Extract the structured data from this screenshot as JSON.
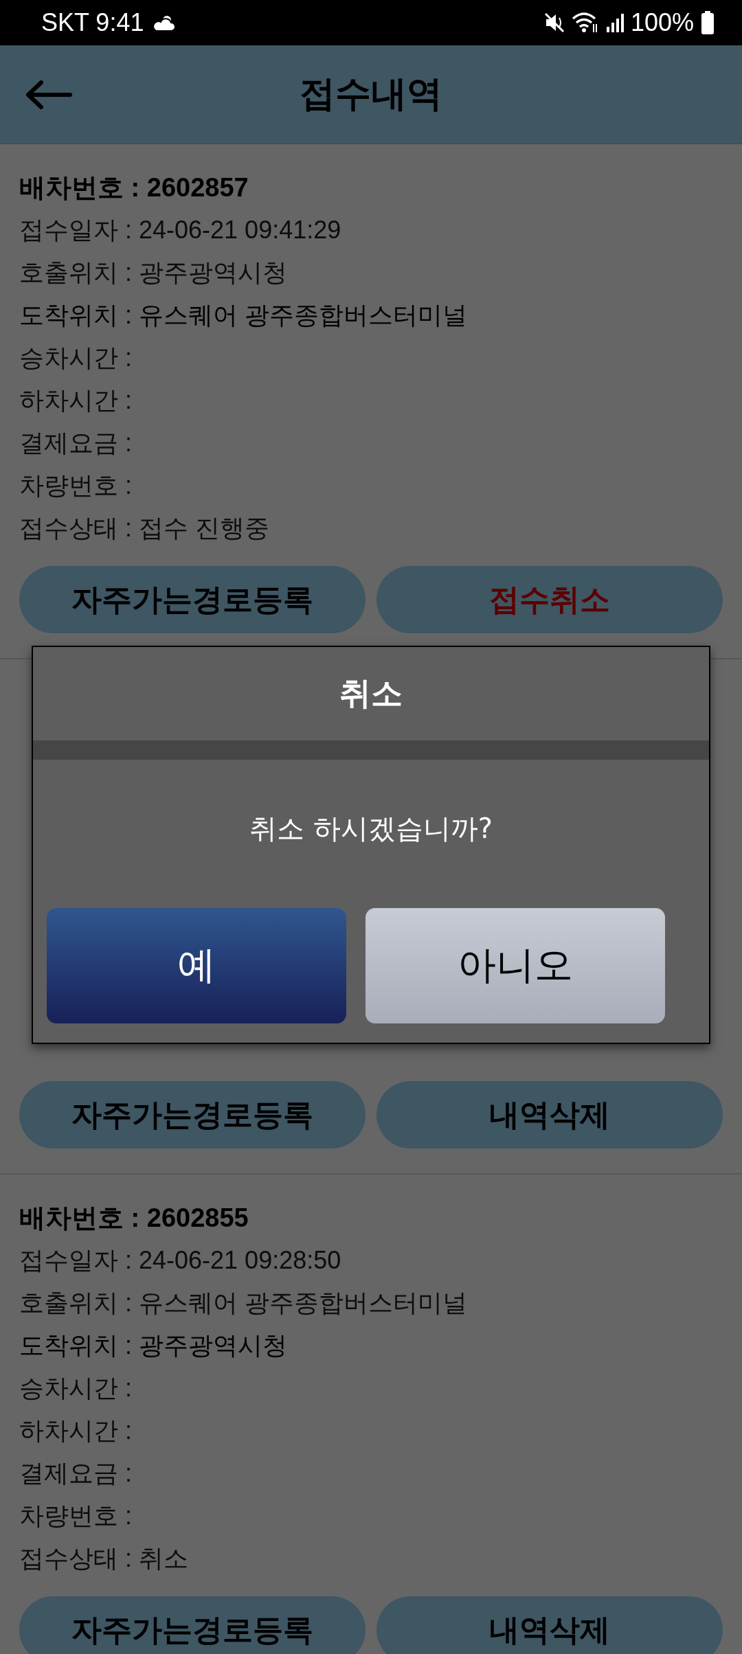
{
  "status_bar": {
    "carrier_time": "SKT 9:41",
    "battery": "100%"
  },
  "header": {
    "title": "접수내역"
  },
  "cards": [
    {
      "rows": [
        {
          "kind": "title",
          "text": "배차번호 : 2602857"
        },
        {
          "kind": "plain",
          "text": "접수일자 : 24-06-21 09:41:29"
        },
        {
          "kind": "plain",
          "text": "호출위치 : 광주광역시청"
        },
        {
          "kind": "strong",
          "text": "도착위치 : 유스퀘어 광주종합버스터미널"
        },
        {
          "kind": "plain",
          "text": "승차시간 :"
        },
        {
          "kind": "plain",
          "text": "하차시간 :"
        },
        {
          "kind": "plain",
          "text": "결제요금 :"
        },
        {
          "kind": "plain",
          "text": "차량번호 :"
        },
        {
          "kind": "plain",
          "text": "접수상태 : 접수 진행중"
        }
      ],
      "buttons": [
        {
          "kind": "normal",
          "label": "자주가는경로등록"
        },
        {
          "kind": "danger",
          "label": "접수취소"
        }
      ]
    },
    {
      "buttons": [
        {
          "kind": "normal",
          "label": "자주가는경로등록"
        },
        {
          "kind": "normal",
          "label": "내역삭제"
        }
      ]
    },
    {
      "rows": [
        {
          "kind": "title",
          "text": "배차번호 : 2602855"
        },
        {
          "kind": "plain",
          "text": "접수일자 : 24-06-21 09:28:50"
        },
        {
          "kind": "plain",
          "text": "호출위치 : 유스퀘어 광주종합버스터미널"
        },
        {
          "kind": "strong",
          "text": "도착위치 : 광주광역시청"
        },
        {
          "kind": "plain",
          "text": "승차시간 :"
        },
        {
          "kind": "plain",
          "text": "하차시간 :"
        },
        {
          "kind": "plain",
          "text": "결제요금 :"
        },
        {
          "kind": "plain",
          "text": "차량번호 :"
        },
        {
          "kind": "plain",
          "text": "접수상태 : 취소"
        }
      ],
      "buttons": [
        {
          "kind": "normal",
          "label": "자주가는경로등록"
        },
        {
          "kind": "normal",
          "label": "내역삭제"
        }
      ]
    }
  ],
  "dialog": {
    "title": "취소",
    "message": "취소 하시겠습니까?",
    "buttons": [
      {
        "kind": "primary",
        "label": "예"
      },
      {
        "kind": "secondary",
        "label": "아니오"
      }
    ]
  }
}
